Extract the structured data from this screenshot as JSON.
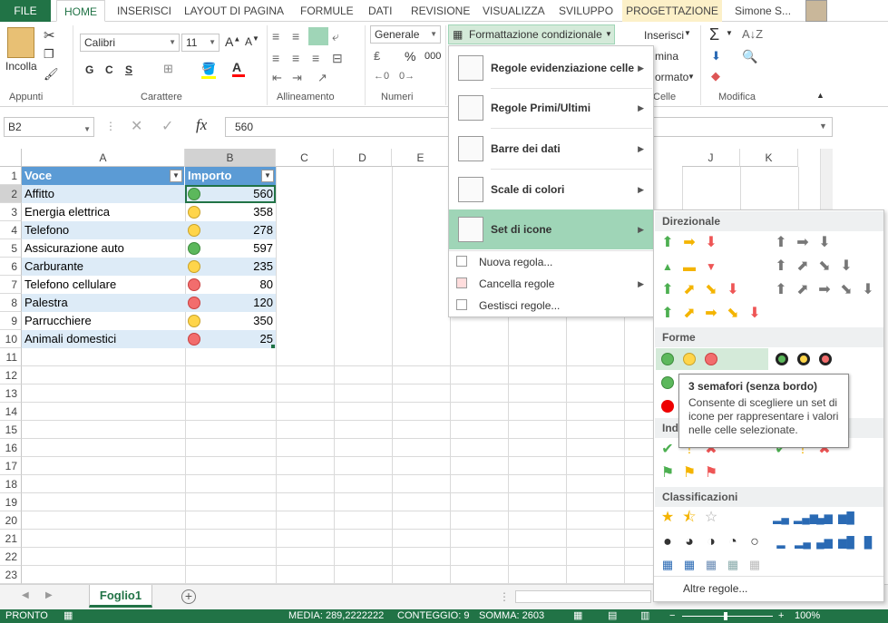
{
  "tabs": [
    "FILE",
    "HOME",
    "INSERISCI",
    "LAYOUT DI PAGINA",
    "FORMULE",
    "DATI",
    "REVISIONE",
    "VISUALIZZA",
    "SVILUPPO",
    "PROGETTAZIONE"
  ],
  "user": "Simone S...",
  "ribbon": {
    "paste": "Incolla",
    "font_name": "Calibri",
    "font_size": "11",
    "bold": "G",
    "italic": "C",
    "underline": "S",
    "number_format": "Generale",
    "percent": "%",
    "thousands": "000",
    "cond_format": "Formattazione condizionale",
    "insert": "Inserisci",
    "delete": "mina",
    "format": "ormato",
    "sigma": "Σ",
    "groups": {
      "clipboard": "Appunti",
      "font": "Carattere",
      "alignment": "Allineamento",
      "number": "Numeri",
      "cells": "Celle",
      "editing": "Modifica"
    }
  },
  "formula_bar": {
    "name_box": "B2",
    "fx": "fx",
    "value": "560"
  },
  "columns": [
    "A",
    "B",
    "C",
    "D",
    "E",
    "",
    "",
    "",
    "J",
    "K"
  ],
  "rows": [
    "1",
    "2",
    "3",
    "4",
    "5",
    "6",
    "7",
    "8",
    "9",
    "10",
    "11",
    "12",
    "13",
    "14",
    "15",
    "16",
    "17",
    "18",
    "19",
    "20",
    "21",
    "22",
    "23"
  ],
  "table": {
    "headers": [
      "Voce",
      "Importo"
    ],
    "data": [
      {
        "voce": "Affitto",
        "importo": "560",
        "icon": "green"
      },
      {
        "voce": "Energia elettrica",
        "importo": "358",
        "icon": "yellow"
      },
      {
        "voce": "Telefono",
        "importo": "278",
        "icon": "yellow"
      },
      {
        "voce": "Assicurazione auto",
        "importo": "597",
        "icon": "green"
      },
      {
        "voce": "Carburante",
        "importo": "235",
        "icon": "yellow"
      },
      {
        "voce": "Telefono cellulare",
        "importo": "80",
        "icon": "red"
      },
      {
        "voce": "Palestra",
        "importo": "120",
        "icon": "red"
      },
      {
        "voce": "Parrucchiere",
        "importo": "350",
        "icon": "yellow"
      },
      {
        "voce": "Animali domestici",
        "importo": "25",
        "icon": "red"
      }
    ]
  },
  "sheet_tab": "Foglio1",
  "status": {
    "ready": "PRONTO",
    "media": "MEDIA: 289,2222222",
    "count": "CONTEGGIO: 9",
    "sum": "SOMMA: 2603",
    "zoom": "100%"
  },
  "menu": {
    "items": [
      "Regole evidenziazione celle",
      "Regole Primi/Ultimi",
      "Barre dei dati",
      "Scale di colori",
      "Set di icone"
    ],
    "small": [
      "Nuova regola...",
      "Cancella regole",
      "Gestisci regole..."
    ]
  },
  "submenu": {
    "sections": [
      "Direzionale",
      "Forme",
      "Indicatori",
      "Classificazioni"
    ],
    "more": "Altre regole..."
  },
  "tooltip": {
    "title": "3 semafori (senza bordo)",
    "body": "Consente di scegliere un set di icone per rappresentare i valori nelle celle selezionate."
  },
  "colors": {
    "accent": "#217346",
    "header_fill": "#5b9bd5",
    "band": "#ddebf7",
    "menu_hover": "#9fd5b7"
  }
}
